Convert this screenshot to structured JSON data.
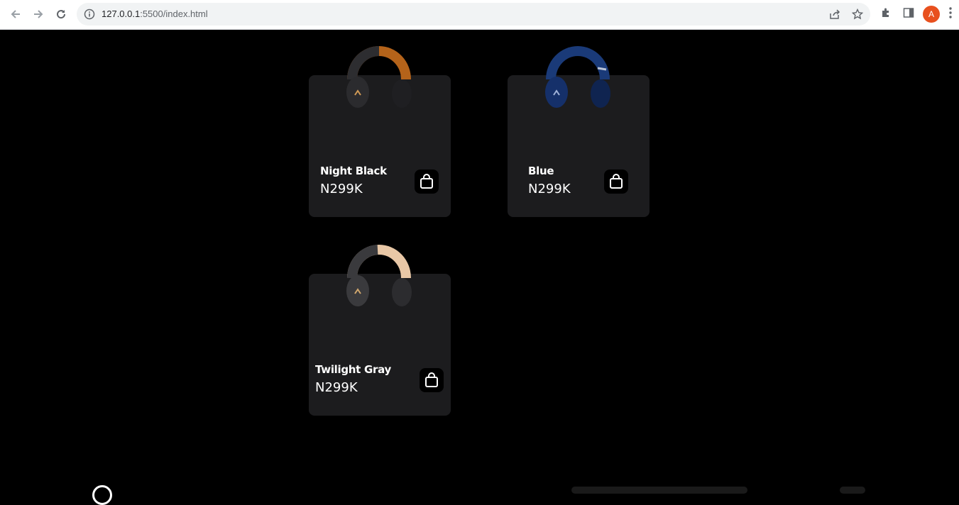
{
  "browser": {
    "url_host": "127.0.0.1",
    "url_rest": ":5500/index.html",
    "profile_initial": "A"
  },
  "products": [
    {
      "name": "Night Black",
      "price": "N299K",
      "color_band": "#b4631a",
      "color_body": "#2d2d30"
    },
    {
      "name": "Blue",
      "price": "N299K",
      "color_band": "#1a3a78",
      "color_body": "#15306a"
    },
    {
      "name": "Twilight Gray",
      "price": "N299K",
      "color_band": "#e8c7a6",
      "color_body": "#3a3a3d"
    }
  ]
}
